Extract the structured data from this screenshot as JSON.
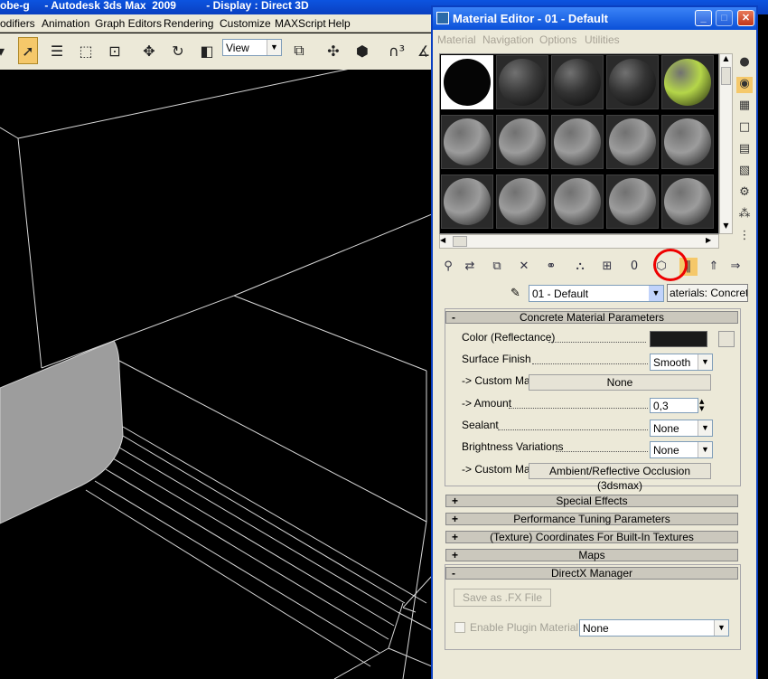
{
  "main_window": {
    "title": "obe-g     - Autodesk 3ds Max  2009          - Display : Direct 3D",
    "menu": [
      "odifiers",
      "Animation",
      "Graph Editors",
      "Rendering",
      "Customize",
      "MAXScript",
      "Help"
    ],
    "view_dropdown": "View"
  },
  "material_editor": {
    "title": "Material Editor - 01 - Default",
    "menu": [
      "Material",
      "Navigation",
      "Options",
      "Utilities"
    ],
    "slots": [
      {
        "color": "#050505"
      },
      {
        "color": "#3a3a3a"
      },
      {
        "color": "#333333"
      },
      {
        "color": "#333333"
      },
      {
        "color": "#b5d649"
      },
      {
        "color": "#9c9c9c"
      },
      {
        "color": "#9c9c9c"
      },
      {
        "color": "#9c9c9c"
      },
      {
        "color": "#9c9c9c"
      },
      {
        "color": "#9c9c9c"
      },
      {
        "color": "#9c9c9c"
      },
      {
        "color": "#9c9c9c"
      },
      {
        "color": "#9c9c9c"
      },
      {
        "color": "#9c9c9c"
      },
      {
        "color": "#9c9c9c"
      }
    ],
    "material_name": "01 - Default",
    "material_type_button": "aterials: Concrete",
    "rollouts": {
      "concrete": {
        "sign": "-",
        "title": "Concrete Material Parameters",
        "color_label": "Color (Reflectance)",
        "color_value": "#1a1a1a",
        "surface_finish_label": "Surface Finish",
        "surface_finish_value": "Smooth",
        "custom_map_label": "-> Custom Map",
        "custom_map_value": "None",
        "amount_label": "-> Amount",
        "amount_value": "0,3",
        "sealant_label": "Sealant",
        "sealant_value": "None",
        "brightness_label": "Brightness Variations",
        "brightness_value": "None",
        "custom_map2_label": "-> Custom Map",
        "custom_map2_value": "Ambient/Reflective Occlusion (3dsmax)"
      },
      "collapsed": [
        {
          "sign": "+",
          "title": "Special Effects"
        },
        {
          "sign": "+",
          "title": "Performance Tuning Parameters"
        },
        {
          "sign": "+",
          "title": "(Texture) Coordinates For Built-In Textures"
        },
        {
          "sign": "+",
          "title": "Maps"
        }
      ],
      "directx": {
        "sign": "-",
        "title": "DirectX Manager",
        "save_button": "Save as .FX File",
        "enable_label": "Enable Plugin Material",
        "plugin_value": "None"
      }
    }
  }
}
